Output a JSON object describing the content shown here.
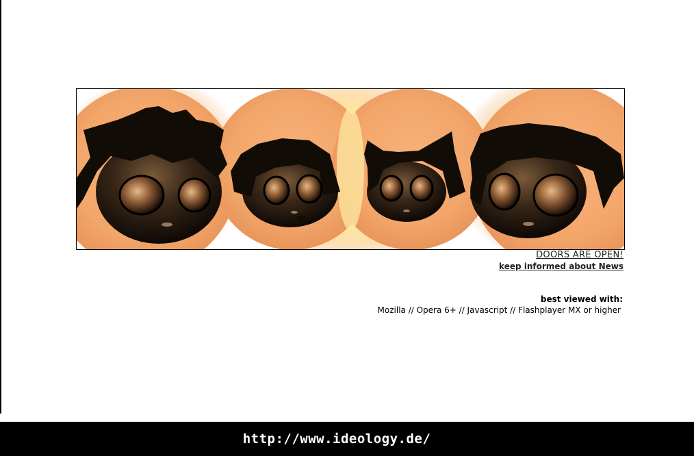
{
  "links": {
    "doors": "DOORS ARE OPEN!",
    "news": "keep informed about News"
  },
  "best_viewed": {
    "title": "best viewed with:",
    "list": "Mozilla // Opera 6+ // Javascript // Flashplayer MX or higher"
  },
  "footer": {
    "url": "http://www.ideology.de/"
  },
  "banner": {
    "characters": [
      "spiky-hair-head",
      "bob-hair-head",
      "cat-ear-head",
      "swept-hair-head"
    ],
    "colors": {
      "orange": "#f3a76a",
      "glow": "#fff3b0",
      "dark": "#1a120c"
    }
  }
}
